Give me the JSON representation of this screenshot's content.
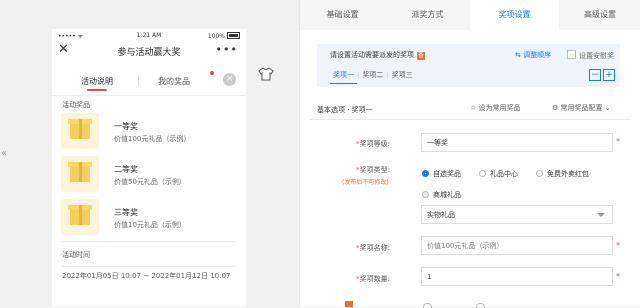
{
  "collapse_icon": "«",
  "phone": {
    "status_signal": "••••• ᯤ",
    "status_time": "1:21 AM",
    "status_battery": "100%",
    "close_symbol": "✕",
    "title": "参与活动赢大奖",
    "more_symbol": "•••",
    "tabs": [
      "活动说明",
      "我的奖品"
    ],
    "tab_close_symbol": "×",
    "section_prizes": "活动奖品",
    "prizes": [
      {
        "name": "一等奖",
        "desc": "价值100元礼品（示例）"
      },
      {
        "name": "二等奖",
        "desc": "价值50元礼品（示例）"
      },
      {
        "name": "三等奖",
        "desc": "价值10元礼品（示例）"
      }
    ],
    "section_time": "活动时间",
    "time_value": "2022年01月05日 10:07 ~ 2022年01月12日 10:07"
  },
  "colors": {
    "accent": "#1677ff",
    "danger": "#e5484d",
    "warn": "#f06c3b",
    "hint_bg": "#f0f5fd"
  },
  "topnav": {
    "items": [
      "基础设置",
      "派奖方式",
      "奖项设置",
      "高级设置"
    ],
    "active_index": 2
  },
  "subcard": {
    "hint": "请设置活动需要派发的奖项",
    "hint_badge": "备",
    "reorder": "⇆ 调整顺序",
    "safety": "设置安慰奖",
    "prize_tabs": [
      "奖项一",
      "奖项二",
      "奖项三"
    ],
    "minus": "−",
    "plus": "+"
  },
  "basic": {
    "title": "基本选项 · 奖项一",
    "set_common": "☆ 设为常用奖品",
    "common_config": "⚙ 常用奖品配置 ⌄"
  },
  "form": {
    "level_label": "奖项等级:",
    "level_value": "一等奖",
    "type_label": "奖项类型:",
    "type_sublabel": "(发布后不可修改)",
    "type_options": [
      "自选奖品",
      "礼品中心",
      "免费外卖红包",
      "商城礼品"
    ],
    "type_selected": "自选奖品",
    "type_select_value": "实物礼品",
    "name_label": "奖项名称:",
    "name_placeholder": "价值100元礼品（示例）",
    "quantity_label": "奖项数量:",
    "quantity_value": "1",
    "required_mark": "*"
  }
}
